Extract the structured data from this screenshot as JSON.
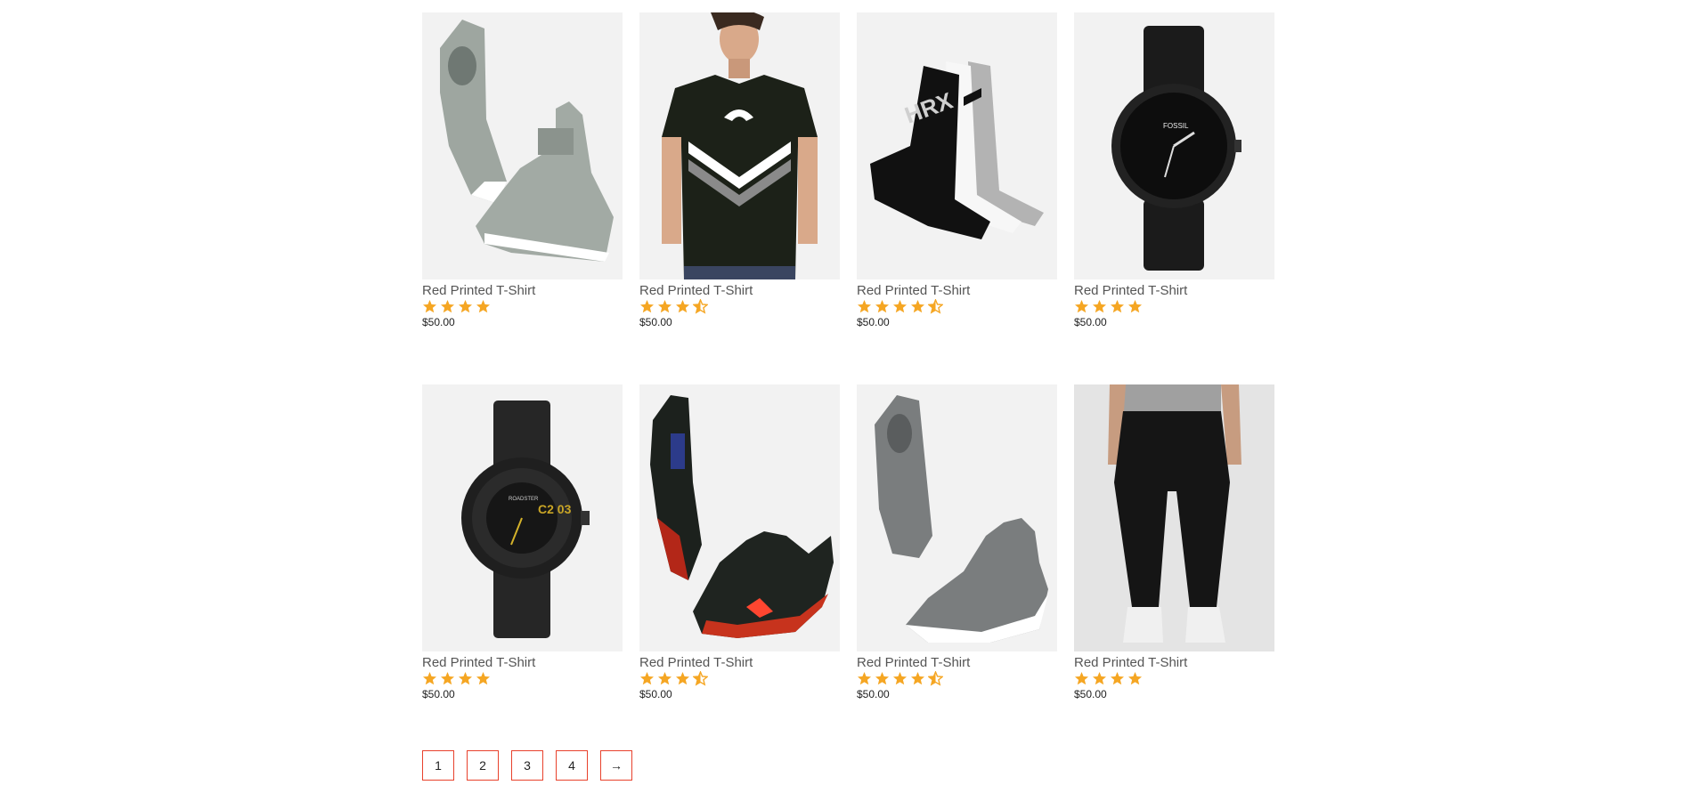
{
  "colors": {
    "star": "#f5a623",
    "pagination_border": "#e8412c",
    "image_bg": "#f2f2f2"
  },
  "products": [
    {
      "title": "Red Printed T-Shirt",
      "rating": 4,
      "price": "$50.00",
      "image": "grey-high-top-sneakers"
    },
    {
      "title": "Red Printed T-Shirt",
      "rating": 3.5,
      "price": "$50.00",
      "image": "black-puma-tshirt"
    },
    {
      "title": "Red Printed T-Shirt",
      "rating": 4.5,
      "price": "$50.00",
      "image": "hrx-socks"
    },
    {
      "title": "Red Printed T-Shirt",
      "rating": 4,
      "price": "$50.00",
      "image": "black-fossil-watch"
    },
    {
      "title": "Red Printed T-Shirt",
      "rating": 4,
      "price": "$50.00",
      "image": "black-roadster-watch"
    },
    {
      "title": "Red Printed T-Shirt",
      "rating": 3.5,
      "price": "$50.00",
      "image": "black-red-sneakers"
    },
    {
      "title": "Red Printed T-Shirt",
      "rating": 4.5,
      "price": "$50.00",
      "image": "grey-slip-on-shoes"
    },
    {
      "title": "Red Printed T-Shirt",
      "rating": 4,
      "price": "$50.00",
      "image": "black-joggers"
    }
  ],
  "pagination": {
    "pages": [
      "1",
      "2",
      "3",
      "4"
    ],
    "next_label": "→"
  }
}
